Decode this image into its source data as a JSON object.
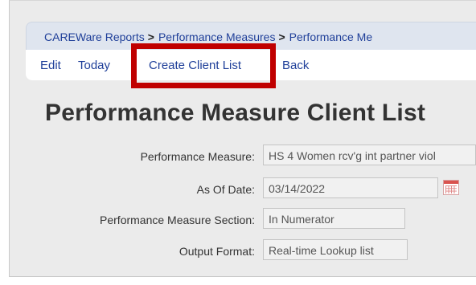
{
  "breadcrumb": {
    "items": [
      "CAREWare Reports",
      "Performance Measures",
      "Performance Me"
    ],
    "separator": ">"
  },
  "actions": [
    "Edit",
    "Today",
    "Create Client List",
    "Back"
  ],
  "page_title": "Performance Measure Client List",
  "form": [
    {
      "label": "Performance Measure:",
      "value": "HS 4 Women rcv'g int partner viol"
    },
    {
      "label": "As Of Date:",
      "value": "03/14/2022"
    },
    {
      "label": "Performance Measure Section:",
      "value": "In Numerator"
    },
    {
      "label": "Output Format:",
      "value": "Real-time Lookup list"
    }
  ],
  "colors": {
    "link": "#1f3f99",
    "highlight_box": "#c00000",
    "panel_bg": "#ebebeb",
    "breadcrumb_bg": "#dfe5ef"
  },
  "icons": {
    "date_picker": "calendar-icon"
  }
}
